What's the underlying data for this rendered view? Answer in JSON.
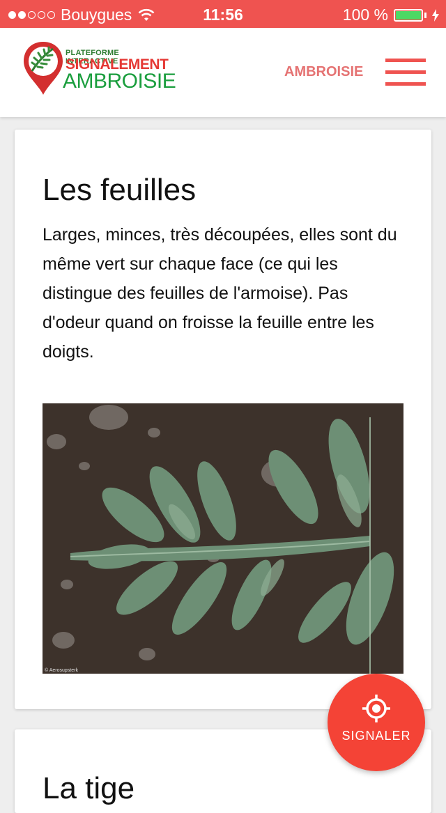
{
  "status_bar": {
    "carrier": "Bouygues",
    "time": "11:56",
    "battery": "100 %"
  },
  "header": {
    "logo": {
      "line1": "PLATEFORME INTERACTIVE",
      "line2": "SIGNALEMENT",
      "line3": "AMBROISIE"
    },
    "nav_label": "AMBROISIE"
  },
  "card1": {
    "title": "Les feuilles",
    "body": "Larges, minces, très découpées, elles sont du même vert sur chaque face (ce qui les distingue des feuilles de l'armoise). Pas d'odeur quand on froisse la feuille entre les doigts.",
    "photo_credit": "© Aerosupsterk"
  },
  "card2": {
    "title": "La tige"
  },
  "fab": {
    "label": "SIGNALER"
  },
  "colors": {
    "accent": "#ef5350",
    "fab": "#f44336",
    "logo_green": "#1b9e3e"
  }
}
